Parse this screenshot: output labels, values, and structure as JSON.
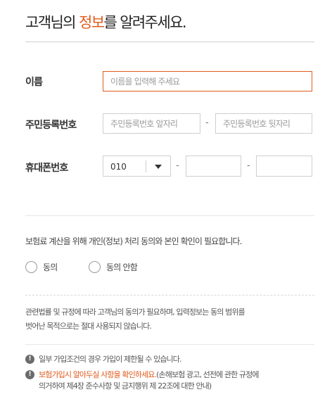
{
  "title": {
    "pre": "고객님의 ",
    "highlight": "정보",
    "post": "를 알려주세요."
  },
  "form": {
    "name_label": "이름",
    "name_placeholder": "이름을 입력해 주세요",
    "rrn_label": "주민등록번호",
    "rrn_front_placeholder": "주민등록번호 앞자리",
    "rrn_separator": "-",
    "rrn_back_placeholder": "주민등록번호 뒷자리",
    "phone_label": "휴대폰번호",
    "phone_prefix": "010",
    "phone_separator": "-"
  },
  "consent": {
    "question": "보험료 계산을 위해 개인(정보) 처리 동의와 본인 확인이 필요합니다.",
    "options": [
      "동의",
      "동의 안함"
    ]
  },
  "notice": {
    "line1": "관련법률 및 규정에 따라 고객님의 동의가 필요하며, 입력정보는 동의 범위를",
    "line2": "벗어난 목적으로는 절대 사용되지 않습니다."
  },
  "info": {
    "item1": "일부 가입조건의 경우 가입이 제한될 수 있습니다.",
    "item2_link": "보험가입시 알아두실 사항을 확인하세요.",
    "item2_rest": "(손해보험 광고, 선전에 관한 규정에",
    "item2_line2": "의거하여 제4장 준수사항 및 금지행위 제 22조에 대한 안내)"
  },
  "icons": {
    "caret": "chevron-down-icon",
    "info": "exclamation-circle-icon"
  },
  "colors": {
    "accent": "#e05a1c"
  }
}
